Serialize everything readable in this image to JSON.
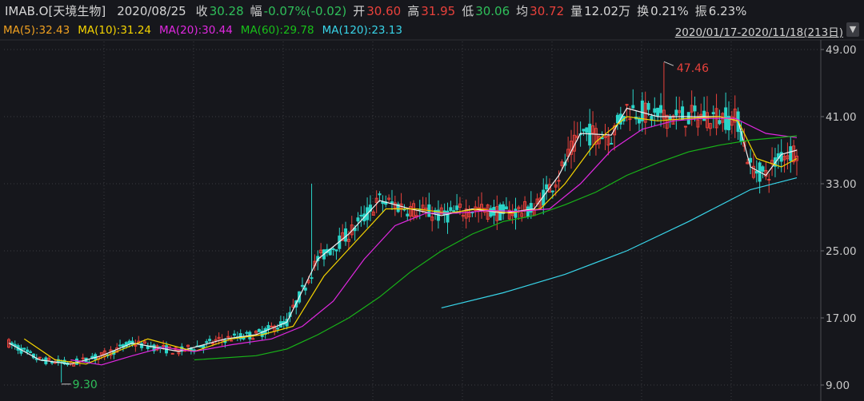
{
  "header": {
    "code": "IMAB.O[天境生物]",
    "date": "2020/08/25",
    "close_label": "收",
    "close_value": "30.28",
    "change_label": "幅",
    "change_value": "-0.07%(-0.02)",
    "open_label": "开",
    "open_value": "30.60",
    "high_label": "高",
    "high_value": "31.95",
    "low_label": "低",
    "low_value": "30.06",
    "avg_label": "均",
    "avg_value": "30.72",
    "volume_label": "量",
    "volume_value": "12.02万",
    "turnover_label": "换",
    "turnover_value": "0.21%",
    "amplitude_label": "振",
    "amplitude_value": "6.23%"
  },
  "ma_legend": {
    "ma5": "MA(5):32.43",
    "ma10": "MA(10):31.24",
    "ma20": "MA(20):30.44",
    "ma60": "MA(60):29.78",
    "ma120": "MA(120):23.13"
  },
  "range_text": "2020/01/17-2020/11/18(213日)",
  "range_arrow_icon": "chevron-down-icon",
  "colors": {
    "background": "#16171c",
    "grid": "#3a3b40",
    "up": "#e8413b",
    "down": "#2ad4c8",
    "ma5": "#f0f0f0",
    "ma10": "#f5d400",
    "ma20": "#e028e0",
    "ma60": "#18b418",
    "ma120": "#38d4e8",
    "label_red": "#e8413b",
    "label_green": "#2fbf5a"
  },
  "chart_data": {
    "type": "candlestick",
    "y_ticks": [
      "49.00",
      "41.00",
      "33.00",
      "25.00",
      "17.00",
      "9.00"
    ],
    "ylim": [
      9,
      49
    ],
    "annotations": {
      "max": "47.46",
      "min": "9.30"
    },
    "x_count": 213,
    "ma_series": {
      "ma5": [
        [
          0,
          14
        ],
        [
          10,
          12
        ],
        [
          20,
          11.5
        ],
        [
          30,
          12.5
        ],
        [
          40,
          14
        ],
        [
          55,
          13
        ],
        [
          70,
          14.5
        ],
        [
          80,
          15
        ],
        [
          90,
          16.5
        ],
        [
          100,
          24
        ],
        [
          110,
          27
        ],
        [
          120,
          31
        ],
        [
          130,
          30
        ],
        [
          140,
          29.2
        ],
        [
          150,
          30
        ],
        [
          160,
          29.5
        ],
        [
          170,
          30
        ],
        [
          178,
          34
        ],
        [
          185,
          39
        ],
        [
          195,
          38.8
        ],
        [
          200,
          42
        ],
        [
          210,
          41
        ],
        [
          220,
          41
        ],
        [
          230,
          41
        ],
        [
          236,
          40.5
        ],
        [
          240,
          35
        ],
        [
          245,
          34
        ],
        [
          250,
          36.5
        ],
        [
          255,
          37
        ]
      ],
      "ma10": [
        [
          5,
          14.5
        ],
        [
          15,
          12
        ],
        [
          25,
          11.5
        ],
        [
          35,
          13
        ],
        [
          45,
          14.5
        ],
        [
          60,
          13
        ],
        [
          72,
          14.5
        ],
        [
          82,
          15
        ],
        [
          92,
          16
        ],
        [
          102,
          22
        ],
        [
          112,
          26
        ],
        [
          122,
          30
        ],
        [
          132,
          30
        ],
        [
          142,
          29.5
        ],
        [
          152,
          30
        ],
        [
          162,
          29.5
        ],
        [
          172,
          30
        ],
        [
          180,
          33
        ],
        [
          190,
          38
        ],
        [
          200,
          41
        ],
        [
          210,
          40.5
        ],
        [
          220,
          40.8
        ],
        [
          230,
          41
        ],
        [
          236,
          40.5
        ],
        [
          242,
          36
        ],
        [
          250,
          35
        ],
        [
          255,
          36
        ]
      ],
      "ma20": [
        [
          20,
          12
        ],
        [
          30,
          11.4
        ],
        [
          40,
          12.5
        ],
        [
          50,
          13.5
        ],
        [
          60,
          13
        ],
        [
          72,
          13.8
        ],
        [
          85,
          14.5
        ],
        [
          95,
          16
        ],
        [
          105,
          19
        ],
        [
          115,
          24
        ],
        [
          125,
          28
        ],
        [
          135,
          29.5
        ],
        [
          145,
          29.5
        ],
        [
          155,
          29.8
        ],
        [
          165,
          29.7
        ],
        [
          175,
          30
        ],
        [
          185,
          33
        ],
        [
          195,
          37
        ],
        [
          205,
          39.5
        ],
        [
          215,
          40.5
        ],
        [
          225,
          40.8
        ],
        [
          235,
          40.8
        ],
        [
          245,
          39
        ],
        [
          255,
          38.5
        ]
      ],
      "ma60": [
        [
          60,
          12
        ],
        [
          80,
          12.5
        ],
        [
          90,
          13.3
        ],
        [
          100,
          15
        ],
        [
          110,
          17
        ],
        [
          120,
          19.5
        ],
        [
          130,
          22.5
        ],
        [
          140,
          25
        ],
        [
          150,
          27
        ],
        [
          160,
          28.5
        ],
        [
          170,
          29.2
        ],
        [
          180,
          30.5
        ],
        [
          190,
          32
        ],
        [
          200,
          34
        ],
        [
          210,
          35.5
        ],
        [
          220,
          36.8
        ],
        [
          230,
          37.6
        ],
        [
          240,
          38.2
        ],
        [
          255,
          38.7
        ]
      ],
      "ma120": [
        [
          140,
          18.2
        ],
        [
          160,
          20
        ],
        [
          180,
          22.2
        ],
        [
          200,
          25
        ],
        [
          220,
          28.5
        ],
        [
          240,
          32.3
        ],
        [
          255,
          33.7
        ]
      ]
    }
  }
}
